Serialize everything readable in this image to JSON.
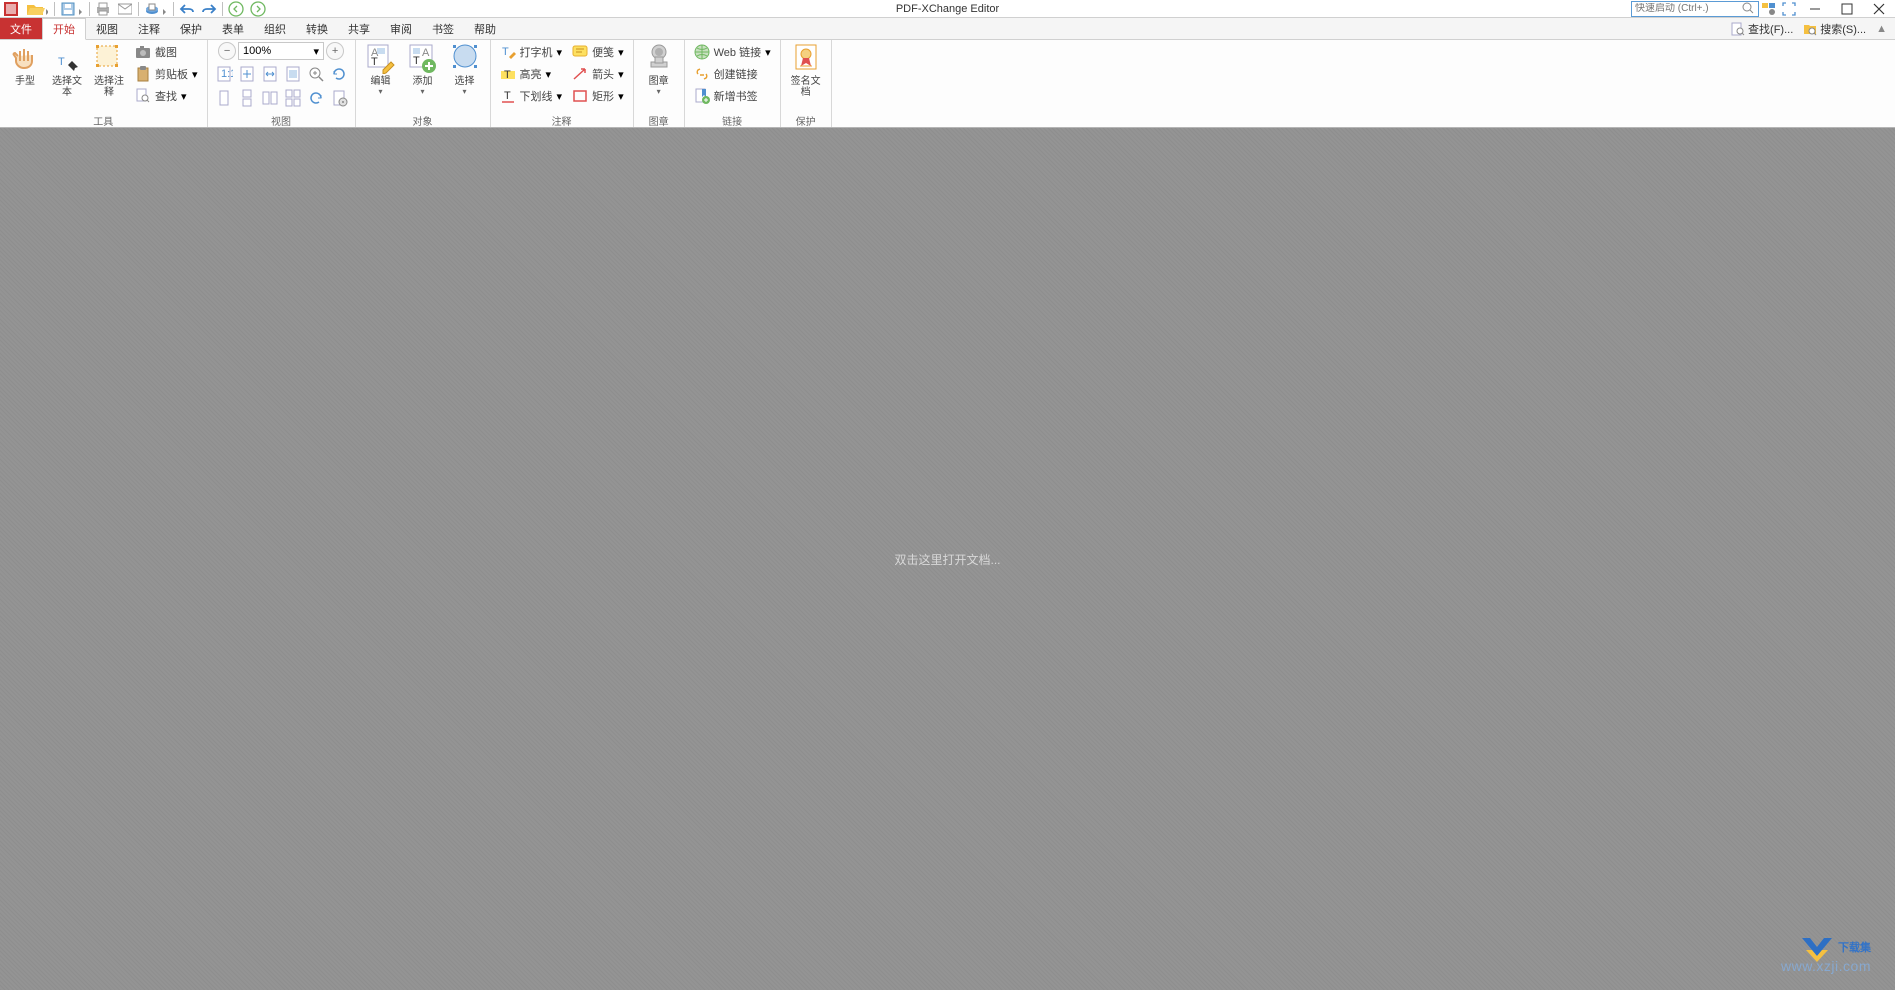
{
  "title": "PDF-XChange Editor",
  "quick_launch_placeholder": "快速启动 (Ctrl+.)",
  "menu": {
    "file": "文件",
    "tabs": [
      "开始",
      "视图",
      "注释",
      "保护",
      "表单",
      "组织",
      "转换",
      "共享",
      "审阅",
      "书签",
      "帮助"
    ],
    "active_index": 0,
    "find": "查找(F)...",
    "search": "搜索(S)..."
  },
  "ribbon": {
    "groups": {
      "tools": {
        "label": "工具",
        "hand": "手型",
        "select_text": "选择文本",
        "select_annot": "选择注释",
        "screenshot": "截图",
        "clipboard": "剪贴板",
        "find": "查找"
      },
      "view": {
        "label": "视图",
        "zoom_value": "100%"
      },
      "object": {
        "label": "对象",
        "edit": "编辑",
        "add": "添加",
        "select": "选择"
      },
      "annotate": {
        "label": "注释",
        "typewriter": "打字机",
        "note": "便笺",
        "highlight": "高亮",
        "arrow": "箭头",
        "underline": "下划线",
        "rect": "矩形"
      },
      "stamp": {
        "label": "图章",
        "stamp": "图章"
      },
      "links": {
        "label": "链接",
        "web_link": "Web 链接",
        "create_link": "创建链接",
        "new_bookmark": "新增书签"
      },
      "protect": {
        "label": "保护",
        "sign_doc": "签名文档"
      }
    }
  },
  "doc_hint": "双击这里打开文档...",
  "watermark": {
    "text": "下载集",
    "sub": "www.xzji.com"
  }
}
